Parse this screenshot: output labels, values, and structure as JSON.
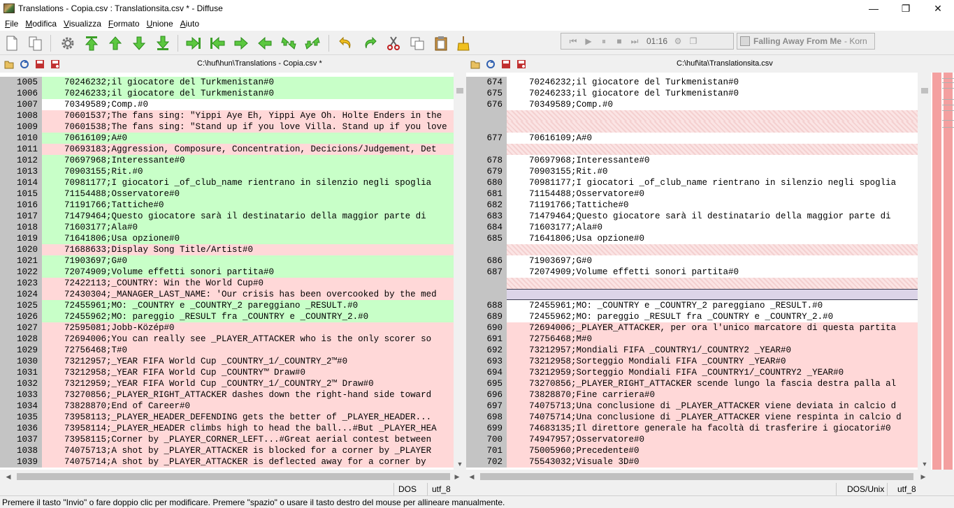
{
  "window": {
    "title": "Translations - Copia.csv : Translationsita.csv * - Diffuse",
    "minimize": "—",
    "restore": "❐",
    "close": "✕"
  },
  "menu": [
    "File",
    "Modifica",
    "Visualizza",
    "Formato",
    "Unione",
    "Aiuto"
  ],
  "toolbar": {
    "icons": [
      "new-file-icon",
      "copy-files-icon",
      "settings-gear-icon",
      "first-change-icon",
      "previous-change-icon",
      "next-change-icon",
      "last-change-icon",
      "merge-right-icon",
      "merge-left-icon",
      "arrow-right-icon",
      "arrow-left-icon",
      "merge-down-icon",
      "merge-up-icon",
      "undo-icon",
      "redo-icon",
      "cut-icon",
      "copy-icon",
      "paste-icon",
      "clear-edits-icon"
    ],
    "media_time": "01:16",
    "song_title": "Falling Away From Me",
    "song_artist": "- Korn"
  },
  "left_pane": {
    "path": "C:\\huf\\hun\\Translations - Copia.csv *",
    "rows": [
      {
        "n": "1005",
        "t": "70246232;il giocatore del Turkmenistan#0",
        "c": "green"
      },
      {
        "n": "1006",
        "t": "70246233;il giocatore del Turkmenistan#0",
        "c": "green"
      },
      {
        "n": "1007",
        "t": "70349589;Comp.#0",
        "c": "white"
      },
      {
        "n": "1008",
        "t": "70601537;The fans sing: \"Yippi Aye Eh, Yippi Aye Oh. Holte Enders in the",
        "c": "red"
      },
      {
        "n": "1009",
        "t": "70601538;The fans sing: \"Stand up if you love Villa. Stand up if you love",
        "c": "red"
      },
      {
        "n": "1010",
        "t": "70616109;A#0",
        "c": "green"
      },
      {
        "n": "1011",
        "t": "70693183;Aggression, Composure, Concentration, Decicions/Judgement, Det",
        "c": "red"
      },
      {
        "n": "1012",
        "t": "70697968;Interessante#0",
        "c": "green"
      },
      {
        "n": "1013",
        "t": "70903155;Rit.#0",
        "c": "green"
      },
      {
        "n": "1014",
        "t": "70981177;I giocatori _of_club_name rientrano in silenzio negli spoglia",
        "c": "green"
      },
      {
        "n": "1015",
        "t": "71154488;Osservatore#0",
        "c": "green"
      },
      {
        "n": "1016",
        "t": "71191766;Tattiche#0",
        "c": "green"
      },
      {
        "n": "1017",
        "t": "71479464;Questo giocatore sarà il destinatario della maggior parte di",
        "c": "green"
      },
      {
        "n": "1018",
        "t": "71603177;Ala#0",
        "c": "green"
      },
      {
        "n": "1019",
        "t": "71641806;Usa opzione#0",
        "c": "green"
      },
      {
        "n": "1020",
        "t": "71688633;Display Song Title/Artist#0",
        "c": "red"
      },
      {
        "n": "1021",
        "t": "71903697;G#0",
        "c": "green"
      },
      {
        "n": "1022",
        "t": "72074909;Volume effetti sonori partita#0",
        "c": "green"
      },
      {
        "n": "1023",
        "t": "72422113;_COUNTRY: Win the World Cup#0",
        "c": "red"
      },
      {
        "n": "1024",
        "t": "72430304;_MANAGER_LAST_NAME: 'Our crisis has been overcooked by the med",
        "c": "red"
      },
      {
        "n": "1025",
        "t": "72455961;MO: _COUNTRY e _COUNTRY_2 pareggiano _RESULT.#0",
        "c": "green"
      },
      {
        "n": "1026",
        "t": "72455962;MO: pareggio _RESULT fra _COUNTRY e _COUNTRY_2.#0",
        "c": "green"
      },
      {
        "n": "1027",
        "t": "72595081;Jobb-Közép#0",
        "c": "red"
      },
      {
        "n": "1028",
        "t": "72694006;You can really see _PLAYER_ATTACKER who is the only scorer so",
        "c": "red"
      },
      {
        "n": "1029",
        "t": "72756468;T#0",
        "c": "red"
      },
      {
        "n": "1030",
        "t": "73212957;_YEAR FIFA World Cup _COUNTRY_1/_COUNTRY_2™#0",
        "c": "red"
      },
      {
        "n": "1031",
        "t": "73212958;_YEAR FIFA World Cup _COUNTRY™ Draw#0",
        "c": "red"
      },
      {
        "n": "1032",
        "t": "73212959;_YEAR FIFA World Cup _COUNTRY_1/_COUNTRY_2™ Draw#0",
        "c": "red"
      },
      {
        "n": "1033",
        "t": "73270856;_PLAYER_RIGHT_ATTACKER dashes down the right-hand side toward",
        "c": "red"
      },
      {
        "n": "1034",
        "t": "73828870;End of Career#0",
        "c": "red"
      },
      {
        "n": "1035",
        "t": "73958113;_PLAYER_HEADER_DEFENDING gets the better of _PLAYER_HEADER...",
        "c": "red"
      },
      {
        "n": "1036",
        "t": "73958114;_PLAYER_HEADER climbs high to head the ball...#But _PLAYER_HEA",
        "c": "red"
      },
      {
        "n": "1037",
        "t": "73958115;Corner by _PLAYER_CORNER_LEFT...#Great aerial contest between",
        "c": "red"
      },
      {
        "n": "1038",
        "t": "74075713;A shot by _PLAYER_ATTACKER is blocked for a corner by _PLAYER",
        "c": "red"
      },
      {
        "n": "1039",
        "t": "74075714;A shot by _PLAYER_ATTACKER is deflected away for a corner by",
        "c": "red"
      }
    ]
  },
  "right_pane": {
    "path": "C:\\huf\\ita\\Translationsita.csv",
    "rows": [
      {
        "n": "674",
        "t": "70246232;il giocatore del Turkmenistan#0",
        "c": "white"
      },
      {
        "n": "675",
        "t": "70246233;il giocatore del Turkmenistan#0",
        "c": "white"
      },
      {
        "n": "676",
        "t": "70349589;Comp.#0",
        "c": "white"
      },
      {
        "n": "",
        "t": "",
        "c": "hatch"
      },
      {
        "n": "",
        "t": "",
        "c": "hatch"
      },
      {
        "n": "677",
        "t": "70616109;A#0",
        "c": "white"
      },
      {
        "n": "",
        "t": "",
        "c": "hatch"
      },
      {
        "n": "678",
        "t": "70697968;Interessante#0",
        "c": "white"
      },
      {
        "n": "679",
        "t": "70903155;Rit.#0",
        "c": "white"
      },
      {
        "n": "680",
        "t": "70981177;I giocatori _of_club_name rientrano in silenzio negli spoglia",
        "c": "white"
      },
      {
        "n": "681",
        "t": "71154488;Osservatore#0",
        "c": "white"
      },
      {
        "n": "682",
        "t": "71191766;Tattiche#0",
        "c": "white"
      },
      {
        "n": "683",
        "t": "71479464;Questo giocatore sarà il destinatario della maggior parte di",
        "c": "white"
      },
      {
        "n": "684",
        "t": "71603177;Ala#0",
        "c": "white"
      },
      {
        "n": "685",
        "t": "71641806;Usa opzione#0",
        "c": "white"
      },
      {
        "n": "",
        "t": "",
        "c": "hatch"
      },
      {
        "n": "686",
        "t": "71903697;G#0",
        "c": "white"
      },
      {
        "n": "687",
        "t": "72074909;Volume effetti sonori partita#0",
        "c": "white"
      },
      {
        "n": "",
        "t": "",
        "c": "hatch"
      },
      {
        "n": "",
        "t": "",
        "c": "lilac"
      },
      {
        "n": "688",
        "t": "72455961;MO: _COUNTRY e _COUNTRY_2 pareggiano _RESULT.#0",
        "c": "white"
      },
      {
        "n": "689",
        "t": "72455962;MO: pareggio _RESULT fra _COUNTRY e _COUNTRY_2.#0",
        "c": "white"
      },
      {
        "n": "690",
        "t": "72694006;_PLAYER_ATTACKER, per ora l'unico marcatore di questa partita",
        "c": "red"
      },
      {
        "n": "691",
        "t": "72756468;M#0",
        "c": "red"
      },
      {
        "n": "692",
        "t": "73212957;Mondiali FIFA _COUNTRY1/_COUNTRY2 _YEAR#0",
        "c": "red"
      },
      {
        "n": "693",
        "t": "73212958;Sorteggio Mondiali FIFA _COUNTRY _YEAR#0",
        "c": "red"
      },
      {
        "n": "694",
        "t": "73212959;Sorteggio Mondiali FIFA _COUNTRY1/_COUNTRY2 _YEAR#0",
        "c": "red"
      },
      {
        "n": "695",
        "t": "73270856;_PLAYER_RIGHT_ATTACKER scende lungo la fascia destra palla al",
        "c": "red"
      },
      {
        "n": "696",
        "t": "73828870;Fine carriera#0",
        "c": "red"
      },
      {
        "n": "697",
        "t": "74075713;Una conclusione di _PLAYER_ATTACKER viene deviata in calcio d",
        "c": "red"
      },
      {
        "n": "698",
        "t": "74075714;Una conclusione di _PLAYER_ATTACKER viene respinta in calcio d",
        "c": "red"
      },
      {
        "n": "699",
        "t": "74683135;Il direttore generale ha facoltà di trasferire i giocatori#0",
        "c": "red"
      },
      {
        "n": "700",
        "t": "74947957;Osservatore#0",
        "c": "red"
      },
      {
        "n": "701",
        "t": "75005960;Precedente#0",
        "c": "red"
      },
      {
        "n": "702",
        "t": "75543032;Visuale 3D#0",
        "c": "red"
      }
    ]
  },
  "left_status": {
    "line_ending": "DOS",
    "encoding": "utf_8"
  },
  "right_status": {
    "line_ending": "DOS/Unix",
    "encoding": "utf_8"
  },
  "status_bar": "Premere il tasto \"Invio\" o fare doppio clic per modificare. Premere \"spazio\" o usare il tasto destro del mouse per allineare manualmente.",
  "colors": {
    "added": "#c8ffc8",
    "changed": "#ffd8d8",
    "gutter": "#c4c4c4",
    "overview": "#f4a0a0"
  }
}
